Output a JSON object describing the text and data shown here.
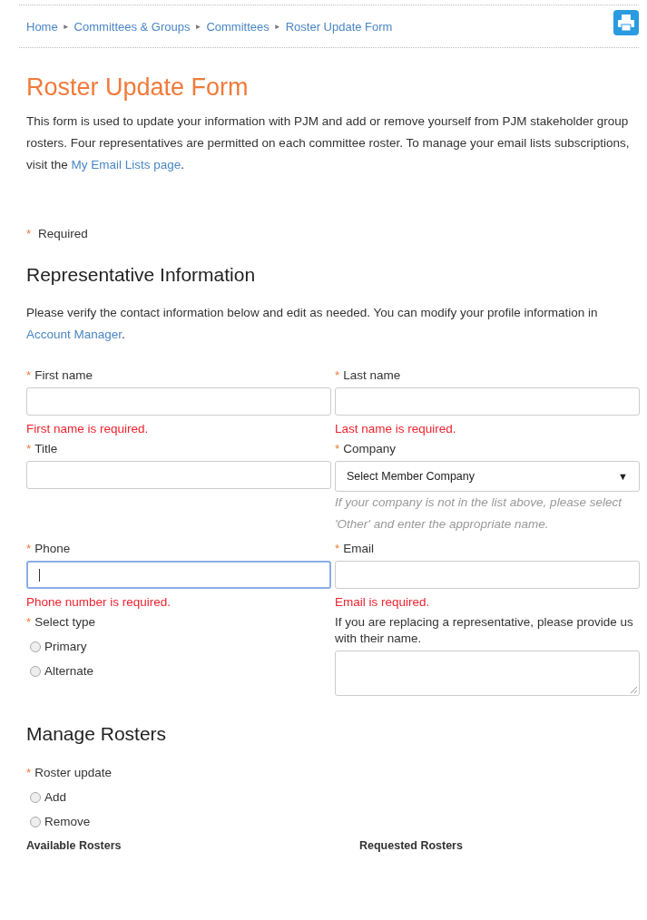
{
  "breadcrumb": [
    {
      "label": "Home",
      "separator": "►"
    },
    {
      "label": "Committees & Groups",
      "separator": "►"
    },
    {
      "label": "Committees",
      "separator": "►"
    },
    {
      "label": "Roster Update Form"
    }
  ],
  "title": "Roster Update Form",
  "intro": {
    "text": "This form is used to update your information with PJM and add or remove yourself from PJM stakeholder group rosters. Four representatives are permitted on each committee roster. To manage your email lists subscriptions, visit the",
    "link": "My Email Lists page",
    "after": "."
  },
  "required_note": {
    "mark": "*",
    "text": "Required"
  },
  "representative": {
    "heading": "Representative Information",
    "text": "Please verify the contact information below and edit as needed.  You can modify your profile information in",
    "link": "Account Manager",
    "after": ".",
    "fields": [
      {
        "kind": "text",
        "label": "First name",
        "required": true,
        "focused": false,
        "error": "First name is required."
      },
      {
        "kind": "text",
        "label": "Last name",
        "required": true,
        "focused": false,
        "error": "Last name is required."
      },
      {
        "kind": "text",
        "label": "Title",
        "required": true,
        "focused": false
      },
      {
        "kind": "select",
        "label": "Company",
        "required": true,
        "value": "Select Member Company",
        "caret": "▼",
        "hint": "If your company is not in the list above, please select 'Other' and enter the appropriate name."
      },
      {
        "kind": "text",
        "label": "Phone",
        "required": true,
        "focused": true,
        "error": "Phone number is required."
      },
      {
        "kind": "text",
        "label": "Email",
        "required": true,
        "focused": false,
        "error": "Email is required."
      },
      {
        "kind": "radio",
        "label": "Select type",
        "required": true,
        "options": [
          {
            "label": "Primary",
            "selected": false
          },
          {
            "label": "Alternate",
            "selected": false
          }
        ]
      },
      {
        "kind": "textarea",
        "label": "If you are replacing a representative, please provide us with their name.",
        "required": false
      }
    ]
  },
  "rosters": {
    "heading": "Manage Rosters",
    "update": {
      "label": "Roster update",
      "required": true,
      "options": [
        {
          "label": "Add",
          "selected": false
        },
        {
          "label": "Remove",
          "selected": false
        }
      ]
    },
    "columns": [
      "Available Rosters",
      "Requested Rosters"
    ]
  }
}
